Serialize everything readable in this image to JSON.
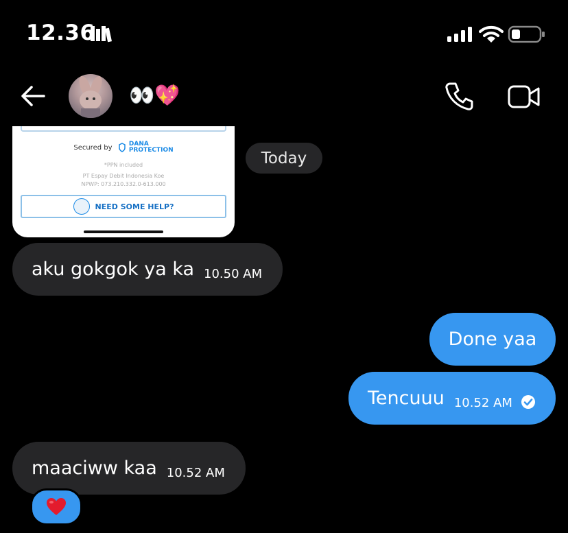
{
  "status_bar": {
    "time": "12.36",
    "icons": [
      "books-icon",
      "signal-icon",
      "wifi-icon",
      "battery-icon"
    ]
  },
  "header": {
    "contact_name": "👀💖",
    "icons": [
      "back-arrow-icon",
      "phone-icon",
      "video-camera-icon"
    ]
  },
  "shared_image": {
    "secured_by": "Secured by",
    "dana_line1": "DANA",
    "dana_line2": "PROTECTION",
    "ppn": "*PPN included",
    "company": "PT Espay Debit Indonesia Koe",
    "npwp": "NPWP: 073.210.332.0-613.000",
    "help_button": "NEED SOME HELP?"
  },
  "date_separator": "Today",
  "messages": [
    {
      "direction": "incoming",
      "text": "aku gokgok ya ka",
      "time": "10.50 AM"
    },
    {
      "direction": "outgoing",
      "text": "Done yaa",
      "time": ""
    },
    {
      "direction": "outgoing",
      "text": "Tencuuu",
      "time": "10.52 AM",
      "status_icon": "seen-check-icon"
    },
    {
      "direction": "incoming",
      "text": "maaciww kaa",
      "time": "10.52 AM",
      "reaction": "❤️"
    }
  ],
  "colors": {
    "background": "#000000",
    "incoming_bubble": "#262628",
    "outgoing_bubble": "#3797f0"
  }
}
